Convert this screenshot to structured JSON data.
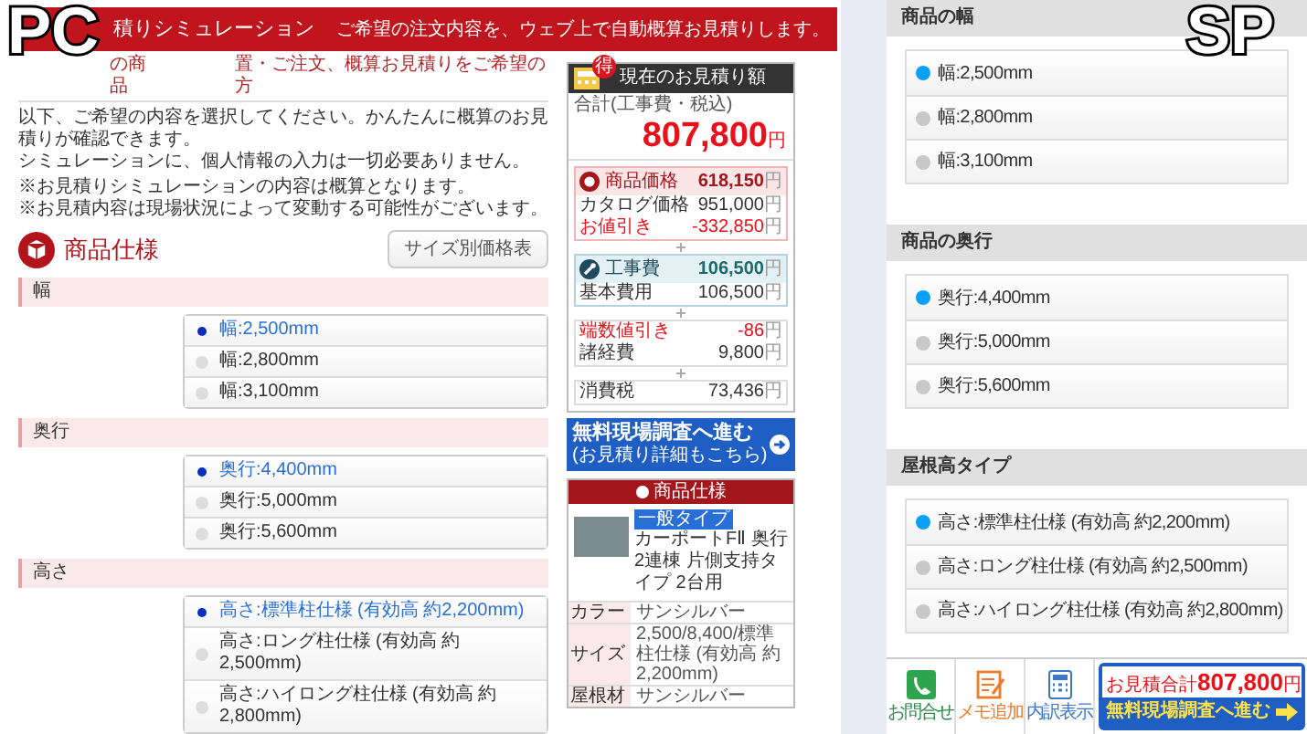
{
  "pc": {
    "header": {
      "title": "積りシミュレーション",
      "tagline": "ご希望の注文内容を、ウェブ上で自動概算お見積りします。"
    },
    "subheading_parts": [
      "の商品",
      "置・ご注文、概算お見積りをご希望の方"
    ],
    "intro": [
      "以下、ご希望の内容を選択してください。かんたんに概算のお見積りが確認できます。",
      "シミュレーションに、個人情報の入力は一切必要ありません。",
      "※お見積りシミュレーションの内容は概算となります。",
      "※お見積内容は現場状況によって変動する可能性がございます。"
    ],
    "section": {
      "title": "商品仕様",
      "button": "サイズ別価格表"
    },
    "groups": [
      {
        "label": "幅",
        "options": [
          {
            "label": "幅:2,500mm",
            "selected": true
          },
          {
            "label": "幅:2,800mm",
            "selected": false
          },
          {
            "label": "幅:3,100mm",
            "selected": false
          }
        ]
      },
      {
        "label": "奥行",
        "options": [
          {
            "label": "奥行:4,400mm",
            "selected": true
          },
          {
            "label": "奥行:5,000mm",
            "selected": false
          },
          {
            "label": "奥行:5,600mm",
            "selected": false
          }
        ]
      },
      {
        "label": "高さ",
        "options": [
          {
            "label": "高さ:標準柱仕様 (有効高 約2,200mm)",
            "selected": true
          },
          {
            "label": "高さ:ロング柱仕様 (有効高 約2,500mm)",
            "selected": false
          },
          {
            "label": "高さ:ハイロング柱仕様 (有効高 約2,800mm)",
            "selected": false
          }
        ]
      }
    ]
  },
  "estimate": {
    "badge": "得",
    "title": "現在のお見積り額",
    "total_label": "合計(工事費・税込)",
    "total": "807,800",
    "unit": "円",
    "blocks": [
      {
        "kind": "product",
        "label": "商品価格",
        "value": "618,150",
        "unit": "円",
        "lines": [
          {
            "label": "カタログ価格",
            "value": "951,000",
            "unit": "円",
            "kind": "normal"
          },
          {
            "label": "お値引き",
            "value": "-332,850",
            "unit": "円",
            "kind": "discount"
          }
        ]
      },
      {
        "kind": "work",
        "label": "工事費",
        "value": "106,500",
        "unit": "円",
        "lines": [
          {
            "label": "基本費用",
            "value": "106,500",
            "unit": "円",
            "kind": "normal"
          }
        ]
      },
      {
        "kind": "plain",
        "lines": [
          {
            "label": "端数値引き",
            "value": "-86",
            "unit": "円",
            "kind": "discount"
          },
          {
            "label": "諸経費",
            "value": "9,800",
            "unit": "円",
            "kind": "normal"
          }
        ]
      },
      {
        "kind": "plain",
        "lines": [
          {
            "label": "消費税",
            "value": "73,436",
            "unit": "円",
            "kind": "normal"
          }
        ]
      }
    ],
    "cta": {
      "title": "無料現場調査へ進む",
      "subtitle": "(お見積り詳細もこちら)"
    },
    "spec": {
      "title": "商品仕様",
      "badge": "一般タイプ",
      "name": "カーポートFⅡ 奥行2連棟 片側支持タイプ 2台用",
      "rows": [
        {
          "label": "カラー",
          "value": "サンシルバー"
        },
        {
          "label": "サイズ",
          "value": "2,500/8,400/標準柱仕様 (有効高 約2,200mm)"
        },
        {
          "label": "屋根材",
          "value": "サンシルバー"
        }
      ]
    }
  },
  "sp": {
    "groups": [
      {
        "title": "商品の幅",
        "options": [
          {
            "label": "幅:2,500mm",
            "selected": true
          },
          {
            "label": "幅:2,800mm",
            "selected": false
          },
          {
            "label": "幅:3,100mm",
            "selected": false
          }
        ]
      },
      {
        "title": "商品の奥行",
        "options": [
          {
            "label": "奥行:4,400mm",
            "selected": true
          },
          {
            "label": "奥行:5,000mm",
            "selected": false
          },
          {
            "label": "奥行:5,600mm",
            "selected": false
          }
        ]
      },
      {
        "title": "屋根高タイプ",
        "options": [
          {
            "label": "高さ:標準柱仕様 (有効高 約2,200mm)",
            "selected": true
          },
          {
            "label": "高さ:ロング柱仕様 (有効高 約2,500mm)",
            "selected": false
          },
          {
            "label": "高さ:ハイロング柱仕様 (有効高 約2,800mm)",
            "selected": false
          }
        ]
      }
    ],
    "bottom_bar": {
      "actions": [
        {
          "kind": "phone",
          "label": "お問合せ"
        },
        {
          "kind": "memo",
          "label": "メモ追加"
        },
        {
          "kind": "calculator",
          "label": "内訳表示"
        }
      ],
      "total_label": "お見積合計",
      "total": "807,800",
      "unit": "円",
      "cta": "無料現場調査へ進む"
    }
  },
  "overlay_labels": [
    "PC",
    "SP"
  ]
}
